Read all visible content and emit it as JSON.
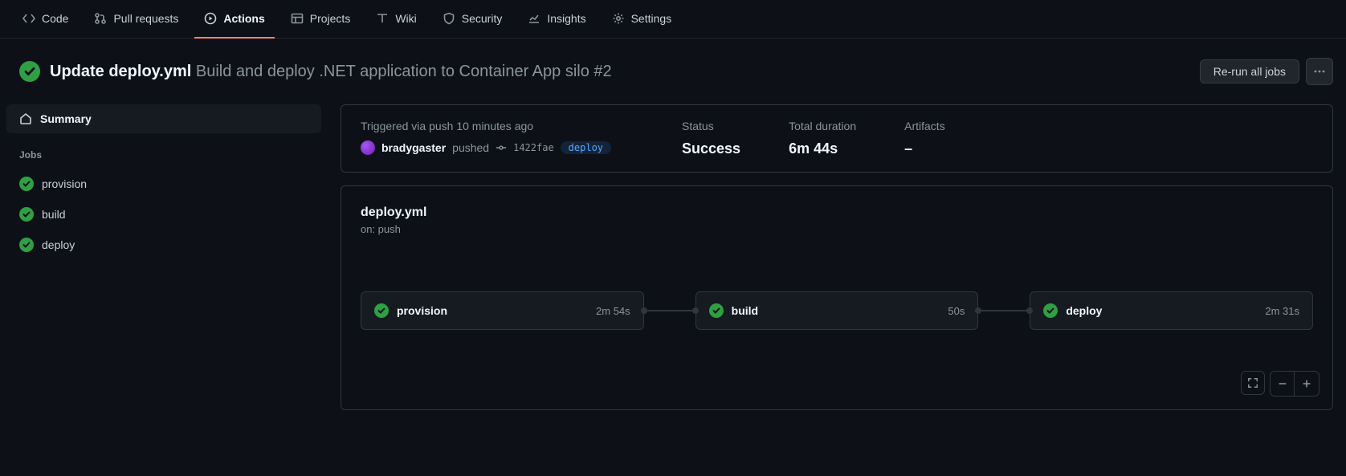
{
  "nav": {
    "items": [
      {
        "label": "Code"
      },
      {
        "label": "Pull requests"
      },
      {
        "label": "Actions"
      },
      {
        "label": "Projects"
      },
      {
        "label": "Wiki"
      },
      {
        "label": "Security"
      },
      {
        "label": "Insights"
      },
      {
        "label": "Settings"
      }
    ]
  },
  "header": {
    "commit_title": "Update deploy.yml",
    "workflow_title": "Build and deploy .NET application to Container App silo #2",
    "rerun_label": "Re-run all jobs"
  },
  "sidebar": {
    "summary_label": "Summary",
    "jobs_heading": "Jobs",
    "jobs": [
      {
        "name": "provision"
      },
      {
        "name": "build"
      },
      {
        "name": "deploy"
      }
    ]
  },
  "summary": {
    "triggered_label": "Triggered via push 10 minutes ago",
    "author": "bradygaster",
    "action": "pushed",
    "sha": "1422fae",
    "branch": "deploy",
    "status_label": "Status",
    "status_value": "Success",
    "duration_label": "Total duration",
    "duration_value": "6m 44s",
    "artifacts_label": "Artifacts",
    "artifacts_value": "–"
  },
  "workflow": {
    "file": "deploy.yml",
    "trigger": "on: push",
    "jobs": [
      {
        "name": "provision",
        "duration": "2m 54s"
      },
      {
        "name": "build",
        "duration": "50s"
      },
      {
        "name": "deploy",
        "duration": "2m 31s"
      }
    ]
  }
}
